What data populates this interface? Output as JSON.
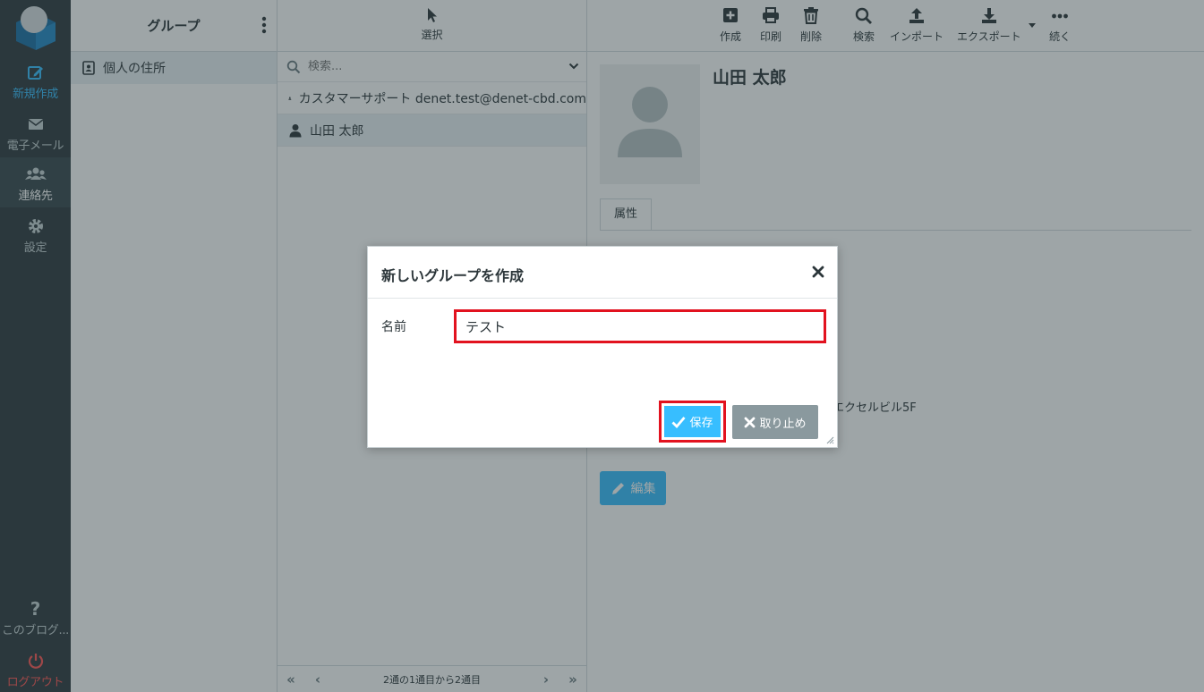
{
  "nav": {
    "items": [
      {
        "label": "新規作成",
        "icon": "compose-icon"
      },
      {
        "label": "電子メール",
        "icon": "envelope-icon"
      },
      {
        "label": "連絡先",
        "icon": "users-icon"
      },
      {
        "label": "設定",
        "icon": "gear-icon"
      }
    ],
    "help_label": "このブログ...",
    "logout_label": "ログアウト"
  },
  "groups": {
    "title": "グループ",
    "items": [
      {
        "label": "個人の住所"
      }
    ]
  },
  "contacts": {
    "select_label": "選択",
    "search_placeholder": "検索...",
    "items": [
      {
        "label": "カスタマーサポート denet.test@denet-cbd.com"
      },
      {
        "label": "山田 太郎"
      }
    ],
    "pager_text": "2通の1通目から2通目"
  },
  "toolbar": {
    "create": "作成",
    "print": "印刷",
    "delete": "削除",
    "search": "検索",
    "import": "インポート",
    "export": "エクスポート",
    "more": "続く"
  },
  "contact_detail": {
    "name": "山田 太郎",
    "tab_label": "属性",
    "address_fragment": "エクセルビル5F",
    "edit_label": "編集"
  },
  "dialog": {
    "title": "新しいグループを作成",
    "field_label": "名前",
    "field_value": "テスト",
    "save_label": "保存",
    "cancel_label": "取り止め"
  },
  "colors": {
    "accent": "#37beff",
    "highlight": "#e2121f",
    "nav_bg": "#2f3a3f",
    "logout": "#ff5552"
  }
}
